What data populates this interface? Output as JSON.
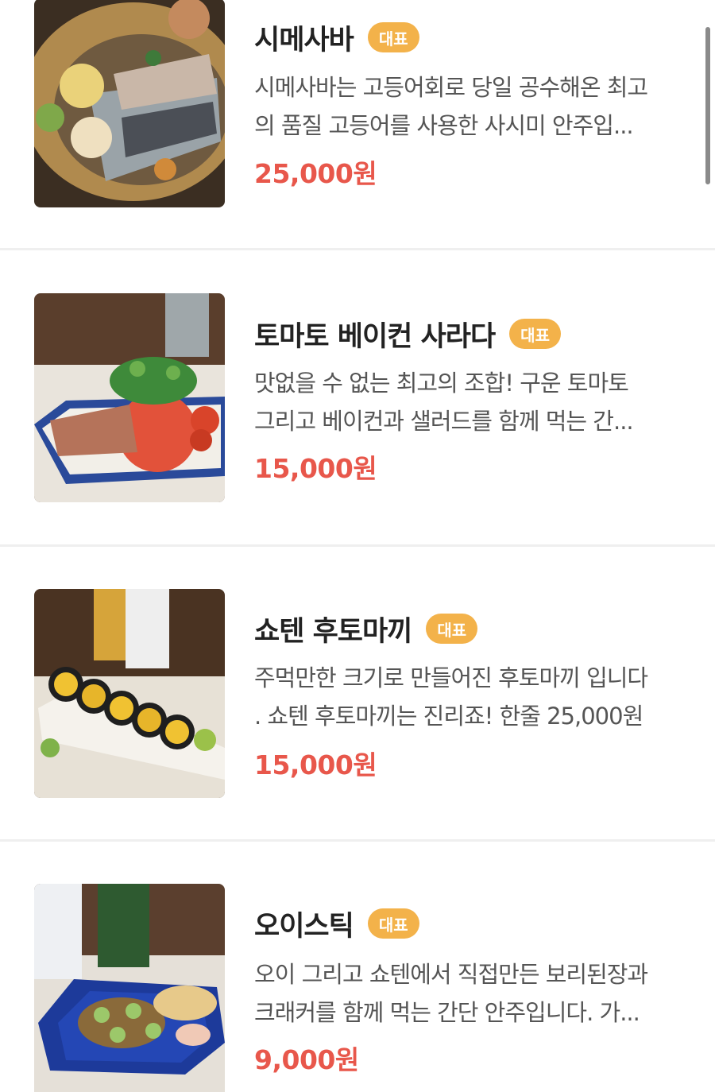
{
  "menu": {
    "items": [
      {
        "name": "시메사바",
        "badge": "대표",
        "desc_line1": "시메사바는 고등어회로 당일 공수해온 최고",
        "desc_line2": "의 품질 고등어를 사용한 사시미 안주입...",
        "price": "25,000원",
        "image_icon": "marinated-mackerel-sashimi-photo"
      },
      {
        "name": "토마토 베이컨 사라다",
        "badge": "대표",
        "desc_line1": "맛없을 수 없는 최고의 조합! 구운 토마토",
        "desc_line2": "그리고 베이컨과 샐러드를 함께 먹는 간...",
        "price": "15,000원",
        "image_icon": "tomato-bacon-salad-photo"
      },
      {
        "name": "쇼텐 후토마끼",
        "badge": "대표",
        "desc_line1": "주먹만한 크기로 만들어진 후토마끼 입니다",
        "desc_line2": ". 쇼텐 후토마끼는 진리죠! 한줄 25,000원",
        "price": "15,000원",
        "image_icon": "futomaki-roll-photo"
      },
      {
        "name": "오이스틱",
        "badge": "대표",
        "desc_line1": "오이 그리고 쇼텐에서 직접만든 보리된장과",
        "desc_line2": "크래커를 함께 먹는 간단 안주입니다. 가...",
        "price": "9,000원",
        "image_icon": "cucumber-stick-photo"
      }
    ]
  },
  "colors": {
    "price": "#e8574b",
    "badge": "#f3b24a",
    "title": "#222222",
    "description": "#555555",
    "divider": "#efefef"
  }
}
